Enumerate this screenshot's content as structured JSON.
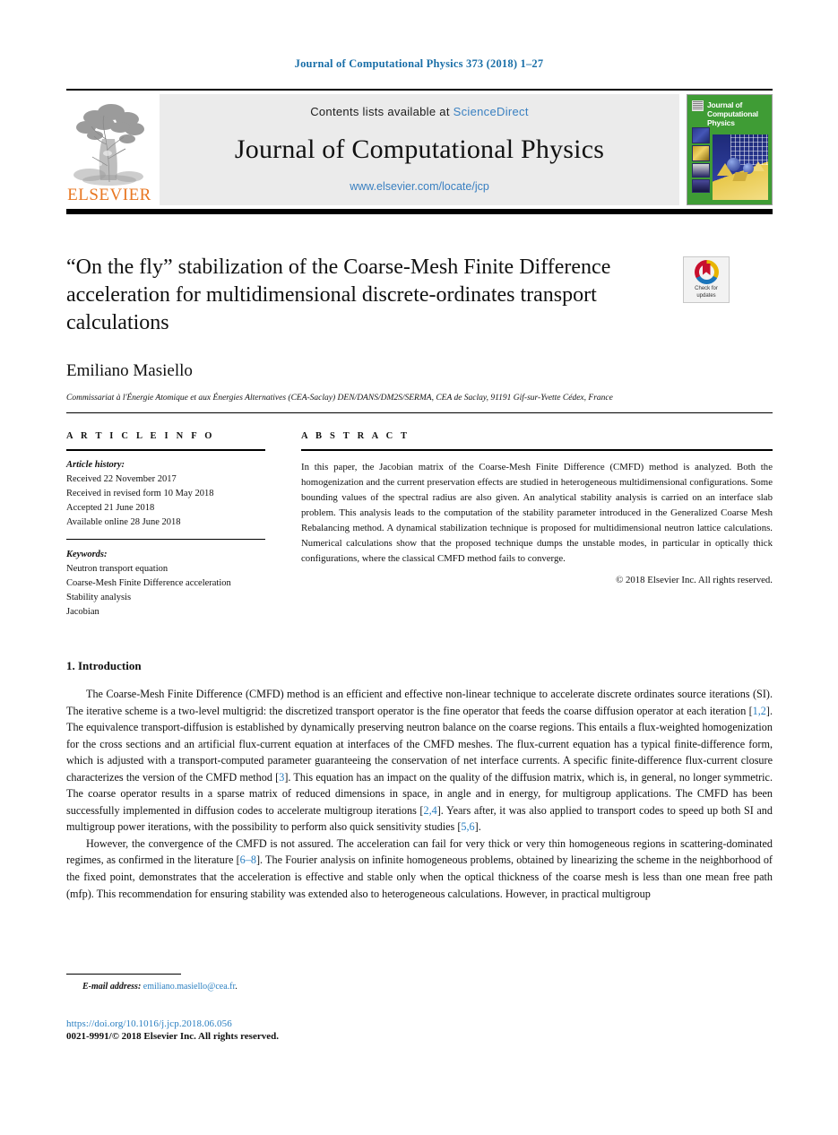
{
  "running_head": "Journal of Computational Physics 373 (2018) 1–27",
  "masthead": {
    "contents_prefix": "Contents lists available at ",
    "sciencedirect": "ScienceDirect",
    "journal_title": "Journal of Computational Physics",
    "journal_url": "www.elsevier.com/locate/jcp",
    "publisher_wordmark": "ELSEVIER",
    "cover_title": "Journal of Computational Physics"
  },
  "crossmark": {
    "line1": "Check for",
    "line2": "updates"
  },
  "article": {
    "title": "“On the fly” stabilization of the Coarse-Mesh Finite Difference acceleration for multidimensional discrete-ordinates transport calculations",
    "author": "Emiliano Masiello",
    "affiliation": "Commissariat à l'Énergie Atomique et aux Énergies Alternatives (CEA-Saclay) DEN/DANS/DM2S/SERMA, CEA de Saclay, 91191 Gif-sur-Yvette Cédex, France"
  },
  "info": {
    "heading": "A R T I C L E    I N F O",
    "history_label": "Article history:",
    "history": [
      "Received 22 November 2017",
      "Received in revised form 10 May 2018",
      "Accepted 21 June 2018",
      "Available online 28 June 2018"
    ],
    "keywords_label": "Keywords:",
    "keywords": [
      "Neutron transport equation",
      "Coarse-Mesh Finite Difference acceleration",
      "Stability analysis",
      "Jacobian"
    ]
  },
  "abstract": {
    "heading": "A B S T R A C T",
    "text": "In this paper, the Jacobian matrix of the Coarse-Mesh Finite Difference (CMFD) method is analyzed. Both the homogenization and the current preservation effects are studied in heterogeneous multidimensional configurations. Some bounding values of the spectral radius are also given. An analytical stability analysis is carried on an interface slab problem. This analysis leads to the computation of the stability parameter introduced in the Generalized Coarse Mesh Rebalancing method. A dynamical stabilization technique is proposed for multidimensional neutron lattice calculations. Numerical calculations show that the proposed technique dumps the unstable modes, in particular in optically thick configurations, where the classical CMFD method fails to converge.",
    "copyright": "© 2018 Elsevier Inc. All rights reserved."
  },
  "section": {
    "title": "1. Introduction",
    "paragraph1_a": "The Coarse-Mesh Finite Difference (CMFD) method is an efficient and effective non-linear technique to accelerate discrete ordinates source iterations (SI). The iterative scheme is a two-level multigrid: the discretized transport operator is the fine operator that feeds the coarse diffusion operator at each iteration [",
    "ref1": "1,2",
    "paragraph1_b": "]. The equivalence transport-diffusion is established by dynamically preserving neutron balance on the coarse regions. This entails a flux-weighted homogenization for the cross sections and an artificial flux-current equation at interfaces of the CMFD meshes. The flux-current equation has a typical finite-difference form, which is adjusted with a transport-computed parameter guaranteeing the conservation of net interface currents. A specific finite-difference flux-current closure characterizes the version of the CMFD method [",
    "ref2": "3",
    "paragraph1_c": "]. This equation has an impact on the quality of the diffusion matrix, which is, in general, no longer symmetric. The coarse operator results in a sparse matrix of reduced dimensions in space, in angle and in energy, for multigroup applications. The CMFD has been successfully implemented in diffusion codes to accelerate multigroup iterations [",
    "ref3": "2,4",
    "paragraph1_d": "]. Years after, it was also applied to transport codes to speed up both SI and multigroup power iterations, with the possibility to perform also quick sensitivity studies [",
    "ref4": "5,6",
    "paragraph1_e": "].",
    "paragraph2_a": "However, the convergence of the CMFD is not assured. The acceleration can fail for very thick or very thin homogeneous regions in scattering-dominated regimes, as confirmed in the literature [",
    "ref5": "6–8",
    "paragraph2_b": "]. The Fourier analysis on infinite homogeneous problems, obtained by linearizing the scheme in the neighborhood of the fixed point, demonstrates that the acceleration is effective and stable only when the optical thickness of the coarse mesh is less than one mean free path (mfp). This recommendation for ensuring stability was extended also to heterogeneous calculations. However, in practical multigroup"
  },
  "footer": {
    "email_label": "E-mail address:",
    "email": "emiliano.masiello@cea.fr",
    "email_suffix": ".",
    "doi": "https://doi.org/10.1016/j.jcp.2018.06.056",
    "issn_line": "0021-9991/© 2018 Elsevier Inc. All rights reserved."
  },
  "colors": {
    "link_blue": "#2a7fc1",
    "header_blue": "#1a6fa8",
    "elsevier_orange": "#e87722",
    "cover_green": "#3f9c35"
  }
}
